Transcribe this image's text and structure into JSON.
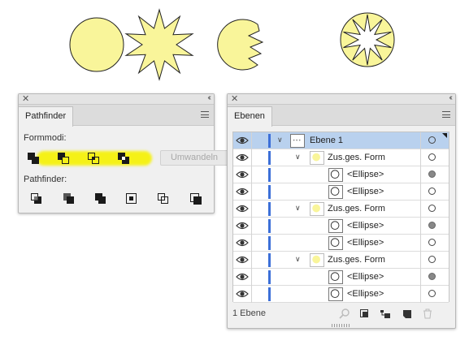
{
  "colors": {
    "shape_fill": "#f9f59a",
    "highlight": "#f6f200",
    "selection": "#b9d1ee",
    "layer_color": "#3c6fd8"
  },
  "pathfinder": {
    "tab_label": "Pathfinder",
    "shape_modes_label": "Formmodi:",
    "pathfinders_label": "Pathfinder:",
    "convert_label": "Umwandeln",
    "shape_mode_icons": [
      "unite-icon",
      "minus-front-icon",
      "intersect-icon",
      "exclude-icon"
    ],
    "pathfinder_icons": [
      "divide-icon",
      "trim-icon",
      "merge-icon",
      "crop-icon",
      "outline-icon",
      "minus-back-icon"
    ]
  },
  "layers_panel": {
    "tab_label": "Ebenen",
    "rows": [
      {
        "label": "Ebene 1",
        "kind": "layer",
        "expanded": true,
        "selected": true,
        "target_filled": false
      },
      {
        "label": "Zus.ges. Form",
        "kind": "compound",
        "expanded": true,
        "selected": false,
        "target_filled": false
      },
      {
        "label": "<Ellipse>",
        "kind": "ellipse",
        "selected": false,
        "target_filled": true
      },
      {
        "label": "<Ellipse>",
        "kind": "ellipse",
        "selected": false,
        "target_filled": false
      },
      {
        "label": "Zus.ges. Form",
        "kind": "compound",
        "expanded": true,
        "selected": false,
        "target_filled": false
      },
      {
        "label": "<Ellipse>",
        "kind": "ellipse",
        "selected": false,
        "target_filled": true
      },
      {
        "label": "<Ellipse>",
        "kind": "ellipse",
        "selected": false,
        "target_filled": false
      },
      {
        "label": "Zus.ges. Form",
        "kind": "compound",
        "expanded": true,
        "selected": false,
        "target_filled": false
      },
      {
        "label": "<Ellipse>",
        "kind": "ellipse",
        "selected": false,
        "target_filled": true
      },
      {
        "label": "<Ellipse>",
        "kind": "ellipse",
        "selected": false,
        "target_filled": false
      }
    ],
    "footer_count": "1 Ebene",
    "footer_icons": [
      "locate-object-icon",
      "make-clipping-mask-icon",
      "new-sublayer-icon",
      "new-layer-icon",
      "delete-icon"
    ]
  }
}
